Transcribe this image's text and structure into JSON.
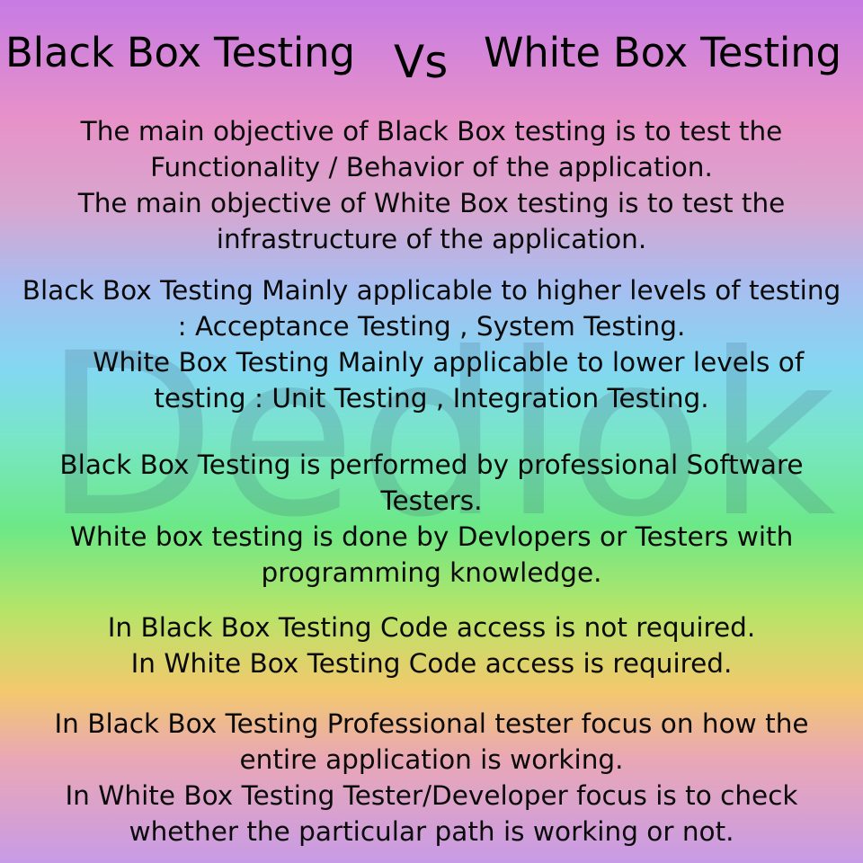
{
  "watermark": "Dedlok",
  "title": {
    "left": "Black Box Testing",
    "vs": "Vs",
    "right": "White Box Testing"
  },
  "sections": [
    {
      "lines": [
        "The main objective of Black Box  testing is to test the",
        "Functionality / Behavior of the application.",
        " The main objective of White Box testing  is to test the",
        "infrastructure of the application."
      ]
    },
    {
      "lines": [
        "Black Box Testing Mainly applicable to higher levels of testing",
        ": Acceptance Testing , System Testing.",
        "    White Box Testing Mainly applicable to lower levels of",
        "testing : Unit Testing , Integration Testing."
      ]
    },
    {
      "lines": [
        "Black Box Testing is performed by professional Software",
        "Testers.",
        "White box testing is done by Devlopers or Testers with",
        "programming knowledge."
      ]
    },
    {
      "lines": [
        "In Black Box Testing Code access is not required.",
        "In White Box Testing Code access is required."
      ]
    },
    {
      "lines": [
        "In Black Box Testing Professional tester focus on how the",
        "entire application is working.",
        "In White Box Testing Tester/Developer focus is to check",
        "whether the particular path is working or not."
      ]
    }
  ]
}
